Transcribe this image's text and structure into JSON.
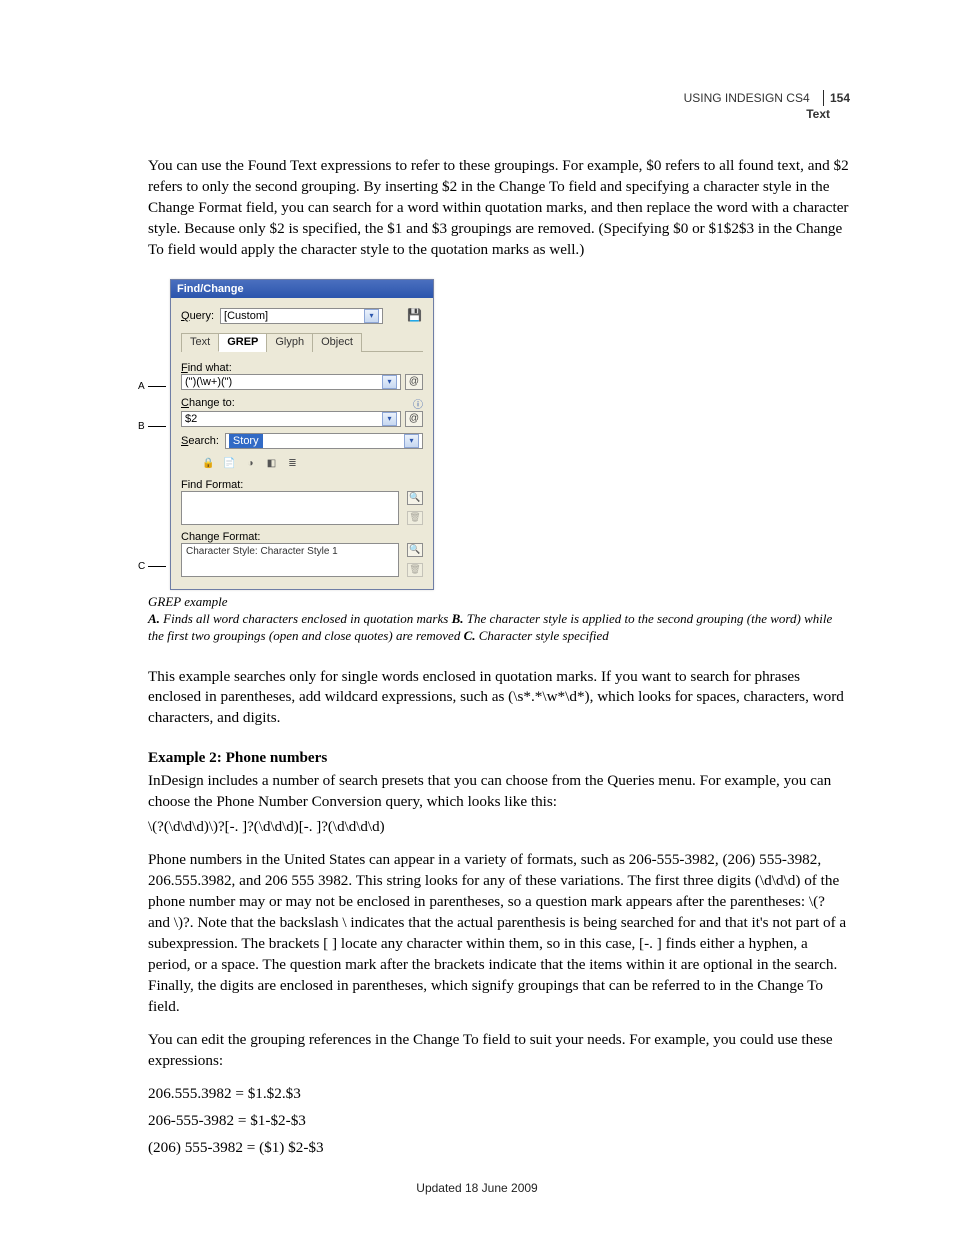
{
  "header": {
    "title": "USING INDESIGN CS4",
    "section": "Text",
    "page_number": "154"
  },
  "paragraphs": {
    "p1": "You can use the Found Text expressions to refer to these groupings. For example, $0 refers to all found text, and $2 refers to only the second grouping. By inserting $2 in the Change To field and specifying a character style in the Change Format field, you can search for a word within quotation marks, and then replace the word with a character style. Because only $2 is specified, the $1 and $3 groupings are removed. (Specifying $0 or $1$2$3 in the Change To field would apply the character style to the quotation marks as well.)",
    "caption_lead": "GREP example",
    "caption_a_key": "A.",
    "caption_a": " Finds all word characters enclosed in quotation marks  ",
    "caption_b_key": "B.",
    "caption_b": " The character style is applied to the second grouping (the word) while the first two groupings (open and close quotes) are removed  ",
    "caption_c_key": "C.",
    "caption_c": " Character style specified",
    "p2": "This example searches only for single words enclosed in quotation marks. If you want to search for phrases enclosed in parentheses, add wildcard expressions, such as (\\s*.*\\w*\\d*), which looks for spaces, characters, word characters, and digits.",
    "h2": "Example 2: Phone numbers",
    "p3": "InDesign includes a number of search presets that you can choose from the Queries menu. For example, you can choose the Phone Number Conversion query, which looks like this:",
    "code1": "\\(?(\\d\\d\\d)\\)?[-. ]?(\\d\\d\\d)[-. ]?(\\d\\d\\d\\d)",
    "p4": "Phone numbers in the United States can appear in a variety of formats, such as 206-555-3982, (206) 555-3982, 206.555.3982, and 206 555 3982. This string looks for any of these variations. The first three digits (\\d\\d\\d) of the phone number may or may not be enclosed in parentheses, so a question mark appears after the parentheses: \\(? and \\)?. Note that the backslash \\ indicates that the actual parenthesis is being searched for and that it's not part of a subexpression. The brackets [ ] locate any character within them, so in this case, [-. ] finds either a hyphen, a period, or a space. The question mark after the brackets indicate that the items within it are optional in the search. Finally, the digits are enclosed in parentheses, which signify groupings that can be referred to in the Change To field.",
    "p5": "You can edit the grouping references in the Change To field to suit your needs. For example, you could use these expressions:",
    "ex1": "206.555.3982 = $1.$2.$3",
    "ex2": "206-555-3982 = $1-$2-$3",
    "ex3": "(206) 555-3982 = ($1) $2-$3"
  },
  "dialog": {
    "title": "Find/Change",
    "query_label": "Query:",
    "query_value": "[Custom]",
    "tabs": {
      "text": "Text",
      "grep": "GREP",
      "glyph": "Glyph",
      "object": "Object"
    },
    "find_what_label": "Find what:",
    "find_what_value": "(\")(\\w+)(\")",
    "change_to_label": "Change to:",
    "change_to_value": "$2",
    "search_label": "Search:",
    "search_value": "Story",
    "find_format_label": "Find Format:",
    "change_format_label": "Change Format:",
    "change_format_value": "Character Style: Character Style 1"
  },
  "callouts": {
    "a": "A",
    "b": "B",
    "c": "C"
  },
  "footer": "Updated 18 June 2009"
}
